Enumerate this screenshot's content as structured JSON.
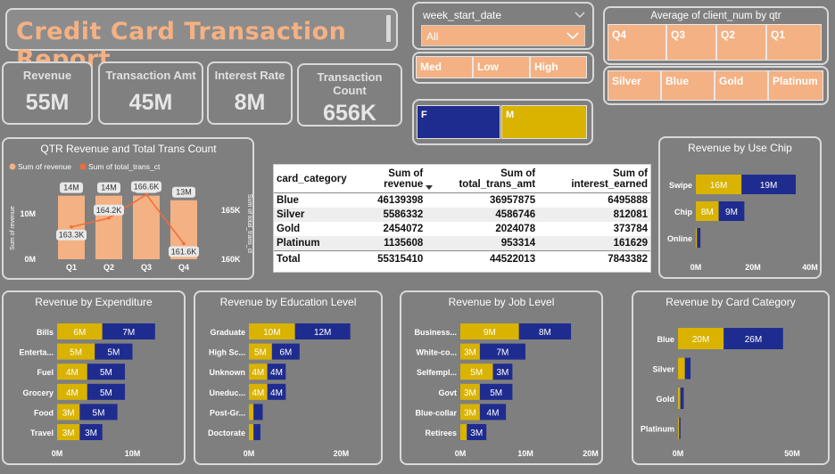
{
  "title": "Credit Card Transaction Report",
  "kpis": [
    {
      "label": "Revenue",
      "value": "55M"
    },
    {
      "label": "Transaction Amt",
      "value": "45M"
    },
    {
      "label": "Interest Rate",
      "value": "8M"
    },
    {
      "label": "Transaction Count",
      "value": "656K"
    }
  ],
  "week_slicer": {
    "label": "week_start_date",
    "selected": "All"
  },
  "income_slicer": [
    "Med",
    "Low",
    "High"
  ],
  "qtr_slicer": {
    "title": "Average of client_num by qtr",
    "items": [
      "Q4",
      "Q3",
      "Q2",
      "Q1"
    ]
  },
  "category_slicer": [
    "Silver",
    "Blue",
    "Gold",
    "Platinum"
  ],
  "gender_bar": {
    "labels": [
      "F",
      "M"
    ],
    "colors": [
      "#1f2c8f",
      "#d9b300"
    ]
  },
  "colors": {
    "gold": "#d9b300",
    "navy": "#1f2c8f",
    "salmon": "#f4b183",
    "line": "#f26b3a"
  },
  "table": {
    "headers": [
      "card_category",
      "Sum of revenue",
      "Sum of total_trans_amt",
      "Sum of interest_earned"
    ],
    "rows": [
      [
        "Blue",
        "46139398",
        "36957875",
        "6495888"
      ],
      [
        "Silver",
        "5586332",
        "4586746",
        "812081"
      ],
      [
        "Gold",
        "2454072",
        "2024078",
        "373784"
      ],
      [
        "Platinum",
        "1135608",
        "953314",
        "161629"
      ]
    ],
    "total": [
      "Total",
      "55315410",
      "44522013",
      "7843382"
    ]
  },
  "chart_data": [
    {
      "type": "bar",
      "title": "QTR Revenue and Total Trans Count",
      "legend": [
        "Sum of revenue",
        "Sum of total_trans_ct"
      ],
      "legend_position": "top-left",
      "categories": [
        "Q1",
        "Q2",
        "Q3",
        "Q4"
      ],
      "series": [
        {
          "name": "Sum of revenue",
          "values": [
            14,
            14,
            14,
            13
          ],
          "labels": [
            "14M",
            "14M",
            "14M",
            "13M"
          ]
        },
        {
          "name": "Sum of total_trans_ct",
          "values": [
            163.3,
            164.2,
            166.6,
            161.6
          ],
          "labels": [
            "163.3K",
            "164.2K",
            "166.6K",
            "161.6K"
          ]
        }
      ],
      "ylabel": "Sum of revenue",
      "y2label": "Sum of total_trans_ct",
      "y_ticks": [
        "10M",
        "0M"
      ],
      "y2_ticks": [
        "165K",
        "160K"
      ]
    },
    {
      "type": "bar",
      "title": "Revenue by Use Chip",
      "categories": [
        "Swipe",
        "Chip",
        "Online"
      ],
      "series": [
        {
          "name": "gold",
          "values": [
            16,
            8,
            0.4
          ],
          "labels": [
            "16M",
            "8M",
            ""
          ]
        },
        {
          "name": "navy",
          "values": [
            19,
            9,
            1.2
          ],
          "labels": [
            "19M",
            "9M",
            ""
          ]
        }
      ],
      "x_ticks": [
        "0M",
        "20M",
        "40M"
      ],
      "xlim": [
        0,
        40
      ]
    },
    {
      "type": "bar",
      "title": "Revenue by Expenditure",
      "categories": [
        "Bills",
        "Enterta...",
        "Fuel",
        "Grocery",
        "Food",
        "Travel"
      ],
      "series": [
        {
          "name": "gold",
          "values": [
            6,
            5,
            4,
            4,
            3,
            3
          ],
          "labels": [
            "6M",
            "5M",
            "4M",
            "4M",
            "3M",
            "3M"
          ]
        },
        {
          "name": "navy",
          "values": [
            7,
            5,
            5,
            5,
            5,
            3
          ],
          "labels": [
            "7M",
            "5M",
            "5M",
            "5M",
            "5M",
            "3M"
          ]
        }
      ],
      "x_ticks": [
        "0M",
        "10M"
      ],
      "xlim": [
        0,
        14
      ]
    },
    {
      "type": "bar",
      "title": "Revenue by Education Level",
      "categories": [
        "Graduate",
        "High Sc...",
        "Unknown",
        "Uneduc...",
        "Post-Gr...",
        "Doctorate"
      ],
      "series": [
        {
          "name": "gold",
          "values": [
            10,
            5,
            4,
            4,
            1,
            1
          ],
          "labels": [
            "10M",
            "5M",
            "4M",
            "4M",
            "",
            ""
          ]
        },
        {
          "name": "navy",
          "values": [
            12,
            6,
            4,
            4,
            2,
            1.5
          ],
          "labels": [
            "12M",
            "6M",
            "4M",
            "4M",
            "",
            ""
          ]
        }
      ],
      "x_ticks": [
        "0M",
        "20M"
      ],
      "xlim": [
        0,
        24
      ]
    },
    {
      "type": "bar",
      "title": "Revenue by Job Level",
      "categories": [
        "Business...",
        "White-co...",
        "Selfempl...",
        "Govt",
        "Blue-collar",
        "Retirees"
      ],
      "series": [
        {
          "name": "gold",
          "values": [
            9,
            3,
            5,
            3,
            3,
            1
          ],
          "labels": [
            "9M",
            "3M",
            "5M",
            "3M",
            "3M",
            ""
          ]
        },
        {
          "name": "navy",
          "values": [
            8,
            7,
            3,
            5,
            4,
            3
          ],
          "labels": [
            "8M",
            "7M",
            "3M",
            "5M",
            "4M",
            "3M"
          ]
        }
      ],
      "x_ticks": [
        "0M",
        "10M",
        "20M"
      ],
      "xlim": [
        0,
        20
      ]
    },
    {
      "type": "bar",
      "title": "Revenue by Card Category",
      "categories": [
        "Blue",
        "Silver",
        "Gold",
        "Platinum"
      ],
      "series": [
        {
          "name": "gold",
          "values": [
            20,
            3,
            1,
            0.5
          ],
          "labels": [
            "20M",
            "",
            "",
            ""
          ]
        },
        {
          "name": "navy",
          "values": [
            26,
            2.5,
            1.5,
            0.6
          ],
          "labels": [
            "26M",
            "",
            "",
            ""
          ]
        }
      ],
      "x_ticks": [
        "0M",
        "50M"
      ],
      "xlim": [
        0,
        50
      ]
    }
  ]
}
